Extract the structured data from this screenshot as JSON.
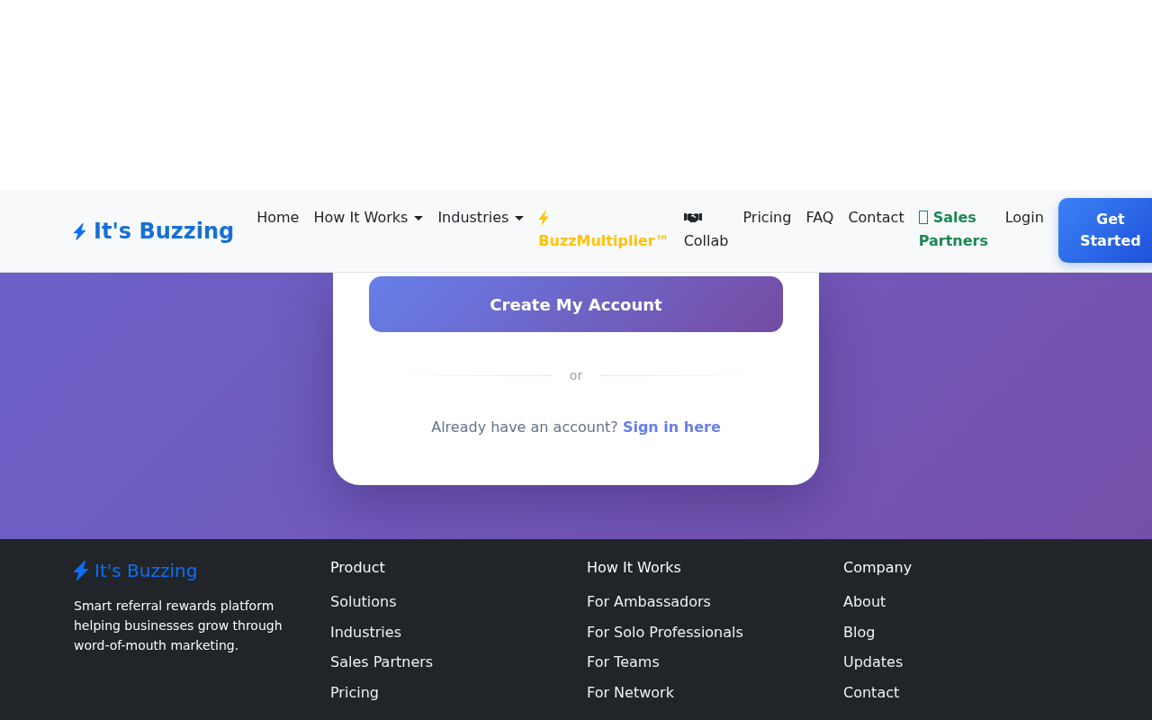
{
  "navbar": {
    "brand": "It's Buzzing",
    "items": [
      {
        "label": "Home",
        "kind": "link"
      },
      {
        "label": "How It Works",
        "kind": "dropdown"
      },
      {
        "label": "Industries",
        "kind": "dropdown"
      },
      {
        "label": "BuzzMultiplier™",
        "kind": "featured",
        "color": "#ffc107"
      },
      {
        "label": "Collab",
        "kind": "community"
      },
      {
        "label": "Pricing",
        "kind": "link"
      },
      {
        "label": "FAQ",
        "kind": "link"
      },
      {
        "label": "Contact",
        "kind": "link"
      },
      {
        "label": "Sales Partners",
        "kind": "partner",
        "color": "#198754"
      },
      {
        "label": "Login",
        "kind": "link"
      }
    ],
    "cta": "Get Started"
  },
  "signup_card": {
    "submit_button": "Create My Account",
    "divider": "or",
    "signin_prompt": "Already have an account?",
    "signin_link": "Sign in here"
  },
  "footer": {
    "brand": "It's Buzzing",
    "description": "Smart referral rewards platform helping businesses grow through word-of-mouth marketing.",
    "columns": [
      {
        "heading": "Product",
        "links": [
          "Solutions",
          "Industries",
          "Sales Partners",
          "Pricing"
        ]
      },
      {
        "heading": "How It Works",
        "links": [
          "For Ambassadors",
          "For Solo Professionals",
          "For Teams",
          "For Network"
        ]
      },
      {
        "heading": "Company",
        "links": [
          "About",
          "Blog",
          "Updates",
          "Contact"
        ]
      }
    ]
  }
}
